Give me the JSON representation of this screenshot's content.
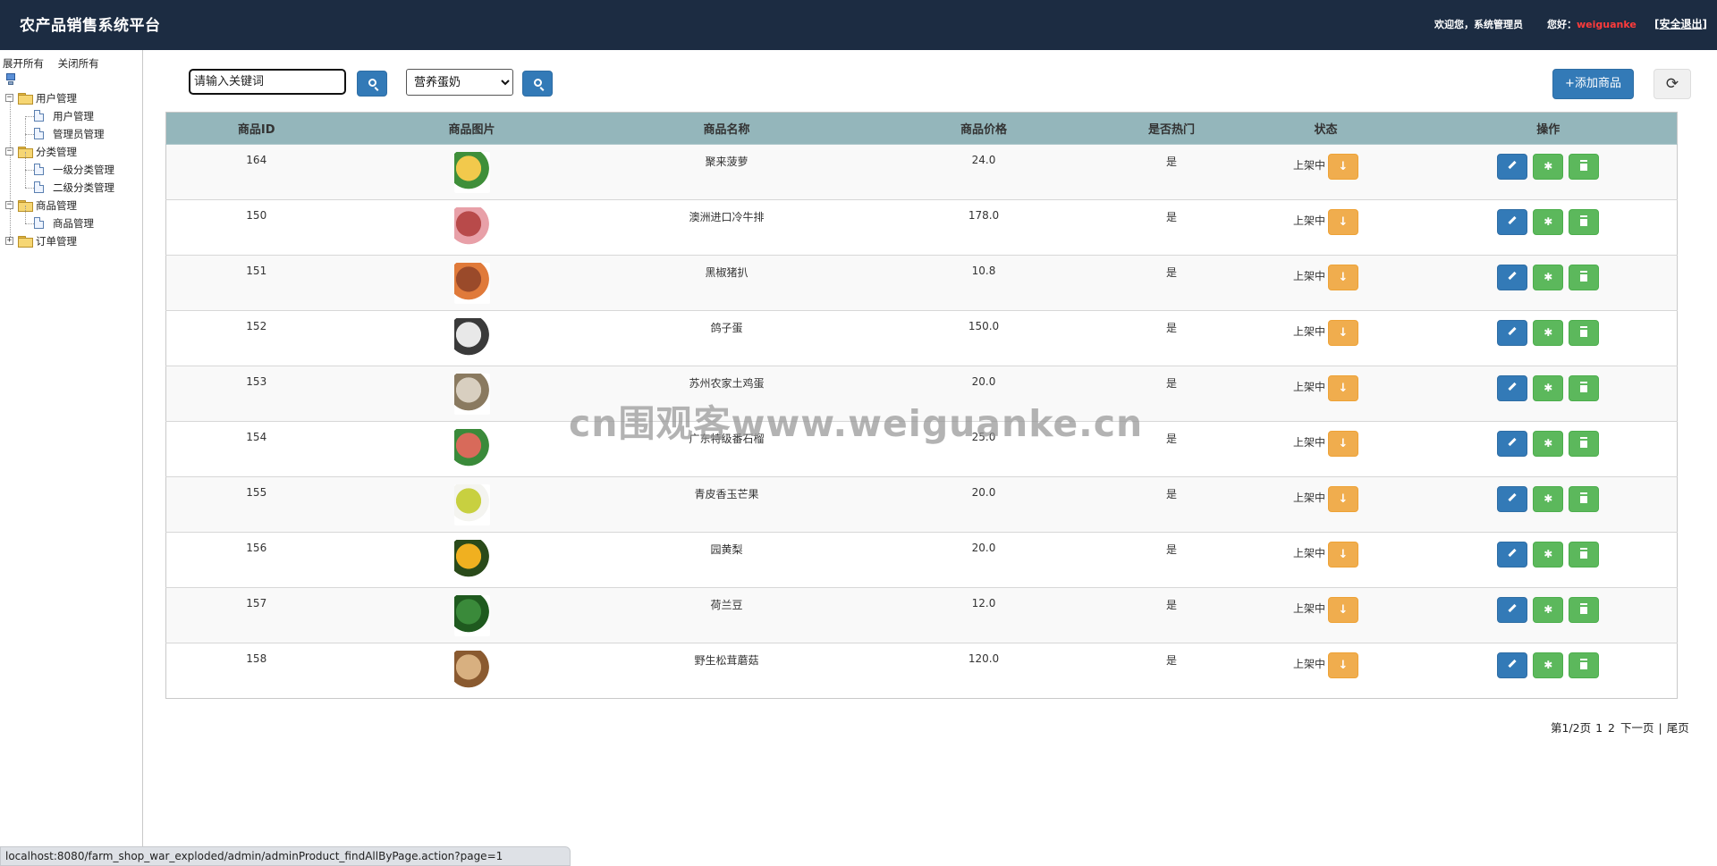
{
  "header": {
    "title": "农产品销售系统平台",
    "welcome": "欢迎您，系统管理员",
    "hello_prefix": "您好：",
    "username": "weiguanke",
    "logout": "安全退出",
    "bg_color": "#1c2c42"
  },
  "sidebar": {
    "expand_all": "展开所有",
    "collapse_all": "关闭所有",
    "groups": [
      {
        "label": "用户管理",
        "items": [
          "用户管理",
          "管理员管理"
        ]
      },
      {
        "label": "分类管理",
        "items": [
          "一级分类管理",
          "二级分类管理"
        ]
      },
      {
        "label": "商品管理",
        "items": [
          "商品管理"
        ]
      },
      {
        "label": "订单管理",
        "items": []
      }
    ]
  },
  "toolbar": {
    "search_placeholder": "请输入关键词",
    "category_selected": "营养蛋奶",
    "add_label": "+添加商品",
    "refresh_icon": "refresh-icon"
  },
  "table": {
    "headers": [
      "商品ID",
      "商品图片",
      "商品名称",
      "商品价格",
      "是否热门",
      "状态",
      "操作"
    ],
    "rows": [
      {
        "id": "164",
        "name": "聚来菠萝",
        "price": "24.0",
        "hot": "是",
        "status": "上架中",
        "image": "pineapple",
        "colors": [
          "#f2c94c",
          "#3f8f3a"
        ]
      },
      {
        "id": "150",
        "name": "澳洲进口冷牛排",
        "price": "178.0",
        "hot": "是",
        "status": "上架中",
        "image": "steak",
        "colors": [
          "#b84a4a",
          "#e8a0a8"
        ]
      },
      {
        "id": "151",
        "name": "黑椒猪扒",
        "price": "10.8",
        "hot": "是",
        "status": "上架中",
        "image": "pork-chop",
        "colors": [
          "#9a4a2a",
          "#e07a3a"
        ]
      },
      {
        "id": "152",
        "name": "鸽子蛋",
        "price": "150.0",
        "hot": "是",
        "status": "上架中",
        "image": "pigeon-eggs",
        "colors": [
          "#e8e8e8",
          "#3a3a3a"
        ]
      },
      {
        "id": "153",
        "name": "苏州农家土鸡蛋",
        "price": "20.0",
        "hot": "是",
        "status": "上架中",
        "image": "chicken-eggs",
        "colors": [
          "#d8cfc0",
          "#8a7a60"
        ]
      },
      {
        "id": "154",
        "name": "广东特级番石榴",
        "price": "25.0",
        "hot": "是",
        "status": "上架中",
        "image": "guava",
        "colors": [
          "#d86a5a",
          "#3a8a3a"
        ]
      },
      {
        "id": "155",
        "name": "青皮香玉芒果",
        "price": "20.0",
        "hot": "是",
        "status": "上架中",
        "image": "mango",
        "colors": [
          "#c8d040",
          "#f4f4f0"
        ]
      },
      {
        "id": "156",
        "name": "园黄梨",
        "price": "20.0",
        "hot": "是",
        "status": "上架中",
        "image": "yellow-pear",
        "colors": [
          "#f0b020",
          "#2a4a1a"
        ]
      },
      {
        "id": "157",
        "name": "荷兰豆",
        "price": "12.0",
        "hot": "是",
        "status": "上架中",
        "image": "snow-peas",
        "colors": [
          "#3a8a3a",
          "#1f5a1f"
        ]
      },
      {
        "id": "158",
        "name": "野生松茸蘑菇",
        "price": "120.0",
        "hot": "是",
        "status": "上架中",
        "image": "matsutake",
        "colors": [
          "#d8b080",
          "#8a5a30"
        ]
      }
    ]
  },
  "pager": {
    "info": "第1/2页",
    "page1": "1",
    "page2": "2",
    "next": "下一页",
    "sep": "|",
    "last": "尾页"
  },
  "statusbar": {
    "url": "localhost:8080/farm_shop_war_exploded/admin/adminProduct_findAllByPage.action?page=1"
  },
  "watermark": "cn围观客www.weiguanke.cn",
  "colors": {
    "primary": "#337ab7",
    "success": "#5cb85c",
    "warning": "#f0ad4e",
    "table_header": "#94b6bb"
  }
}
